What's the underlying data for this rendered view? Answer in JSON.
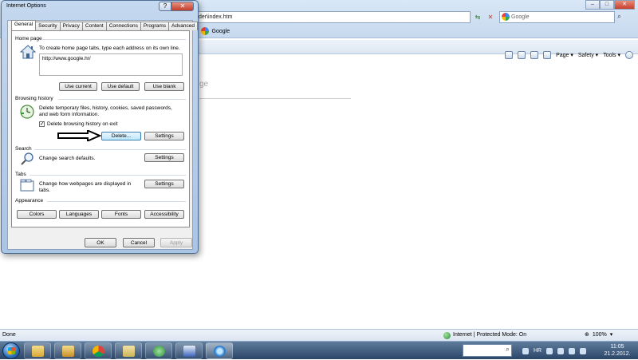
{
  "browser": {
    "address": "der\\index.htm",
    "search_placeholder": "Google",
    "favorites_item": "Google",
    "command_bar": {
      "page": "Page ▾",
      "safety": "Safety ▾",
      "tools": "Tools ▾"
    },
    "content_fragment": "ge",
    "status": {
      "left": "Done",
      "zone": "Internet | Protected Mode: On",
      "zoom": "100%"
    }
  },
  "dialog": {
    "title": "Internet Options",
    "help_glyph": "?",
    "close_glyph": "✕",
    "tabs": [
      {
        "label": "General",
        "active": true
      },
      {
        "label": "Security"
      },
      {
        "label": "Privacy"
      },
      {
        "label": "Content"
      },
      {
        "label": "Connections"
      },
      {
        "label": "Programs"
      },
      {
        "label": "Advanced"
      }
    ],
    "home_page": {
      "label": "Home page",
      "description": "To create home page tabs, type each address on its own line.",
      "url": "http://www.google.hr/",
      "buttons": {
        "use_current": "Use current",
        "use_default": "Use default",
        "use_blank": "Use blank"
      }
    },
    "browsing_history": {
      "label": "Browsing history",
      "description_line1": "Delete temporary files, history, cookies, saved passwords,",
      "description_line2": "and web form information.",
      "checkbox_label": "Delete browsing history on exit",
      "checkbox_checked": true,
      "delete_button": "Delete...",
      "settings_button": "Settings"
    },
    "search": {
      "label": "Search",
      "description": "Change search defaults.",
      "settings_button": "Settings"
    },
    "tabs_group": {
      "label": "Tabs",
      "description_line1": "Change how webpages are displayed in",
      "description_line2": "tabs.",
      "settings_button": "Settings"
    },
    "appearance": {
      "label": "Appearance",
      "buttons": {
        "colors": "Colors",
        "languages": "Languages",
        "fonts": "Fonts",
        "accessibility": "Accessibility"
      }
    },
    "footer": {
      "ok": "OK",
      "cancel": "Cancel",
      "apply": "Apply"
    }
  },
  "taskbar": {
    "language": "HR",
    "time": "11:05",
    "date": "21.2.2012."
  },
  "colors": {
    "accent_focus": "#3c7fb1",
    "taskbar": "#2b4568",
    "dialog_frame": "#aac4e4"
  }
}
